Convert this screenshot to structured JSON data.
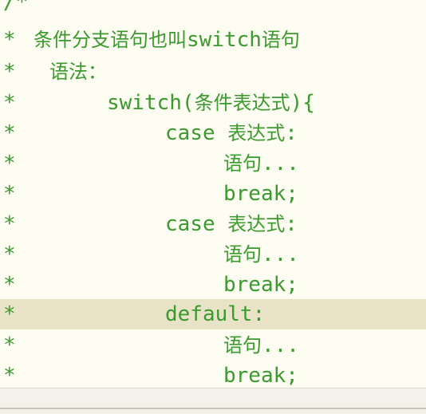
{
  "editor": {
    "lines": [
      {
        "star": "/*",
        "parts": []
      },
      {
        "star": "*",
        "parts": [
          {
            "t": "条件分支语句也叫",
            "c": "cn"
          },
          {
            "t": "switch",
            "c": "kw"
          },
          {
            "t": "语句",
            "c": "cn"
          }
        ]
      },
      {
        "star": "*",
        "parts": [
          {
            "t": "语法：",
            "c": "cn"
          }
        ]
      },
      {
        "star": "*",
        "parts": [
          {
            "t": "switch(",
            "c": "kw"
          },
          {
            "t": "条件表达式",
            "c": "cn"
          },
          {
            "t": "){",
            "c": "kw"
          }
        ]
      },
      {
        "star": "*",
        "parts": [
          {
            "t": "case ",
            "c": "kw"
          },
          {
            "t": "表达式",
            "c": "cn"
          },
          {
            "t": ":",
            "c": "kw"
          }
        ]
      },
      {
        "star": "*",
        "parts": [
          {
            "t": "语句",
            "c": "cn"
          },
          {
            "t": "...",
            "c": "kw"
          }
        ]
      },
      {
        "star": "*",
        "parts": [
          {
            "t": "break;",
            "c": "kw"
          }
        ]
      },
      {
        "star": "*",
        "parts": [
          {
            "t": "case ",
            "c": "kw"
          },
          {
            "t": "表达式",
            "c": "cn"
          },
          {
            "t": ":",
            "c": "kw"
          }
        ]
      },
      {
        "star": "*",
        "parts": [
          {
            "t": "语句",
            "c": "cn"
          },
          {
            "t": "...",
            "c": "kw"
          }
        ]
      },
      {
        "star": "*",
        "parts": [
          {
            "t": "break;",
            "c": "kw"
          }
        ]
      },
      {
        "star": "*",
        "parts": [
          {
            "t": "default:",
            "c": "kw"
          }
        ]
      },
      {
        "star": "*",
        "parts": [
          {
            "t": "语句",
            "c": "cn"
          },
          {
            "t": "...",
            "c": "kw"
          }
        ]
      },
      {
        "star": "*",
        "parts": [
          {
            "t": "break;",
            "c": "kw"
          }
        ]
      }
    ],
    "active_line": 10,
    "colors": {
      "comment": "#3a9a2e",
      "background": "#fefdf2",
      "active_line": "#e8e3c6"
    }
  }
}
